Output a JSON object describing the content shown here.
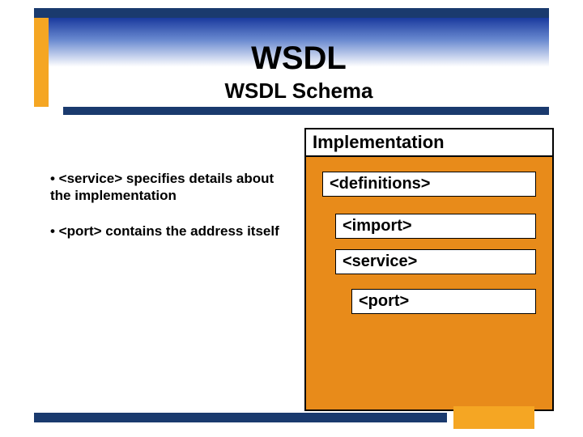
{
  "header": {
    "title": "WSDL",
    "subtitle": "WSDL Schema"
  },
  "bullets": {
    "b1": "• <service> specifies details about the implementation",
    "b2": "• <port> contains the address itself"
  },
  "diagram": {
    "title": "Implementation",
    "definitions": "<definitions>",
    "import": "<import>",
    "service": "<service>",
    "port": "<port>"
  }
}
